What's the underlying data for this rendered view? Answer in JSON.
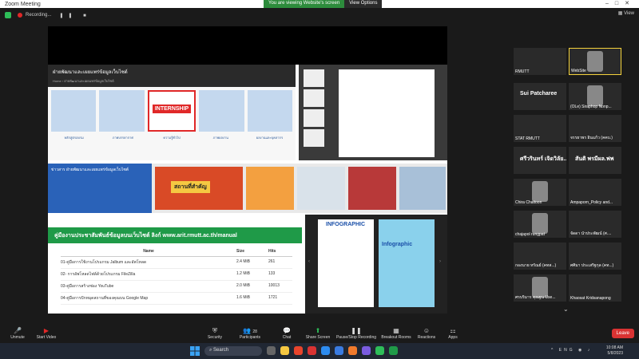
{
  "window": {
    "title": "Zoom Meeting"
  },
  "share_banner": {
    "message": "You are viewing Website's screen",
    "options": "View Options"
  },
  "topbar": {
    "recording": "Recording...",
    "view": "View"
  },
  "slide": {
    "site_header": "ฝ่ายพัฒนาและเผยแพร่ข้อมูลเว็บไซต์",
    "breadcrumb": "Home  ›  ฝ่ายพัฒนาและเผยแพร่ข้อมูลเว็บไซต์",
    "internship_badge": "INTERNSHIP",
    "card_labels": [
      "หลักสูตรอบรม",
      "ภาพบรรยากาศ",
      "ความรู้ทั่วไป",
      "ภาพผลงาน",
      "ผลงานและบุคลากร"
    ],
    "news_title": "ข่าวสาร ฝ่ายพัฒนาและเผยแพร่ข้อมูลเว็บไซต์",
    "event_label": "สถานที่สำคัญ",
    "manual_banner": "คู่มืองานประชาสัมพันธ์ข้อมูลบนเว็บไซต์ ลิงก์ www.arit.rmutt.ac.th/manual",
    "table": {
      "headers": [
        "Name",
        "Size",
        "Hits"
      ],
      "rows": [
        [
          "01-คู่มือการใช้งานโปรแกรม Jalbum และอัพโหลด",
          "2.4 MiB",
          "261"
        ],
        [
          "02- การอัพโหลดไฟล์ด้วยโปรแกรม FileZilla",
          "1.2 MiB",
          "133"
        ],
        [
          "03-คู่มือการสร้างช่อง YouTube",
          "2.0 MiB",
          "10013"
        ],
        [
          "04-คู่มือการปักหมุดสถานที่ของคุณบน Google Map",
          "1.6 MiB",
          "1721"
        ]
      ]
    },
    "infographic_title": "INFOGRAPHIC",
    "infographic_subtitle": "Infographic"
  },
  "participants": [
    {
      "name": "RMUTT",
      "active": false
    },
    {
      "name": "WebSite",
      "active": true
    },
    {
      "name": "Sui Patcharee",
      "big": true
    },
    {
      "name": "(OLe) Siraphop Nonp..."
    },
    {
      "name": "STAT RMUTT"
    },
    {
      "name": "จรรยาพร อินแก้ว (คคบ.)"
    },
    {
      "name": "ศรีวรินทร์ เจิดวิลัย...",
      "big": true
    },
    {
      "name": "สันติ พรมีผล.ฟพ",
      "big": true
    },
    {
      "name": "Chira Chaitoon"
    },
    {
      "name": "Ampaporn_Policy and..."
    },
    {
      "name": "chajapol rungpat"
    },
    {
      "name": "จัดดา นำประพัฒน์ (ศ...."
    },
    {
      "name": "กองนาย หรัณย์ (คทส...)"
    },
    {
      "name": "ศศิมา ประเสริฐกุล (คท...)"
    },
    {
      "name": "ศรบริมาร คุณฐน Use..."
    },
    {
      "name": "Khaosat Kridsanapong"
    }
  ],
  "toolbar": {
    "unmute": "Unmute",
    "start_video": "Start Video",
    "security": "Security",
    "participants": "Participants",
    "participants_count": "28",
    "chat": "Chat",
    "share_screen": "Share Screen",
    "pause_recording": "Pause/Stop Recording",
    "breakout": "Breakout Rooms",
    "reactions": "Reactions",
    "apps": "Apps",
    "leave": "Leave"
  },
  "taskbar": {
    "search": "Search",
    "lang": "ENG",
    "time": "10:08 AM",
    "date": "5/8/2023"
  },
  "colors": {
    "share_green": "#2d8c3c",
    "leave_red": "#d93333",
    "active_yellow": "#f5d23c",
    "manual_green": "#1f9a48"
  }
}
